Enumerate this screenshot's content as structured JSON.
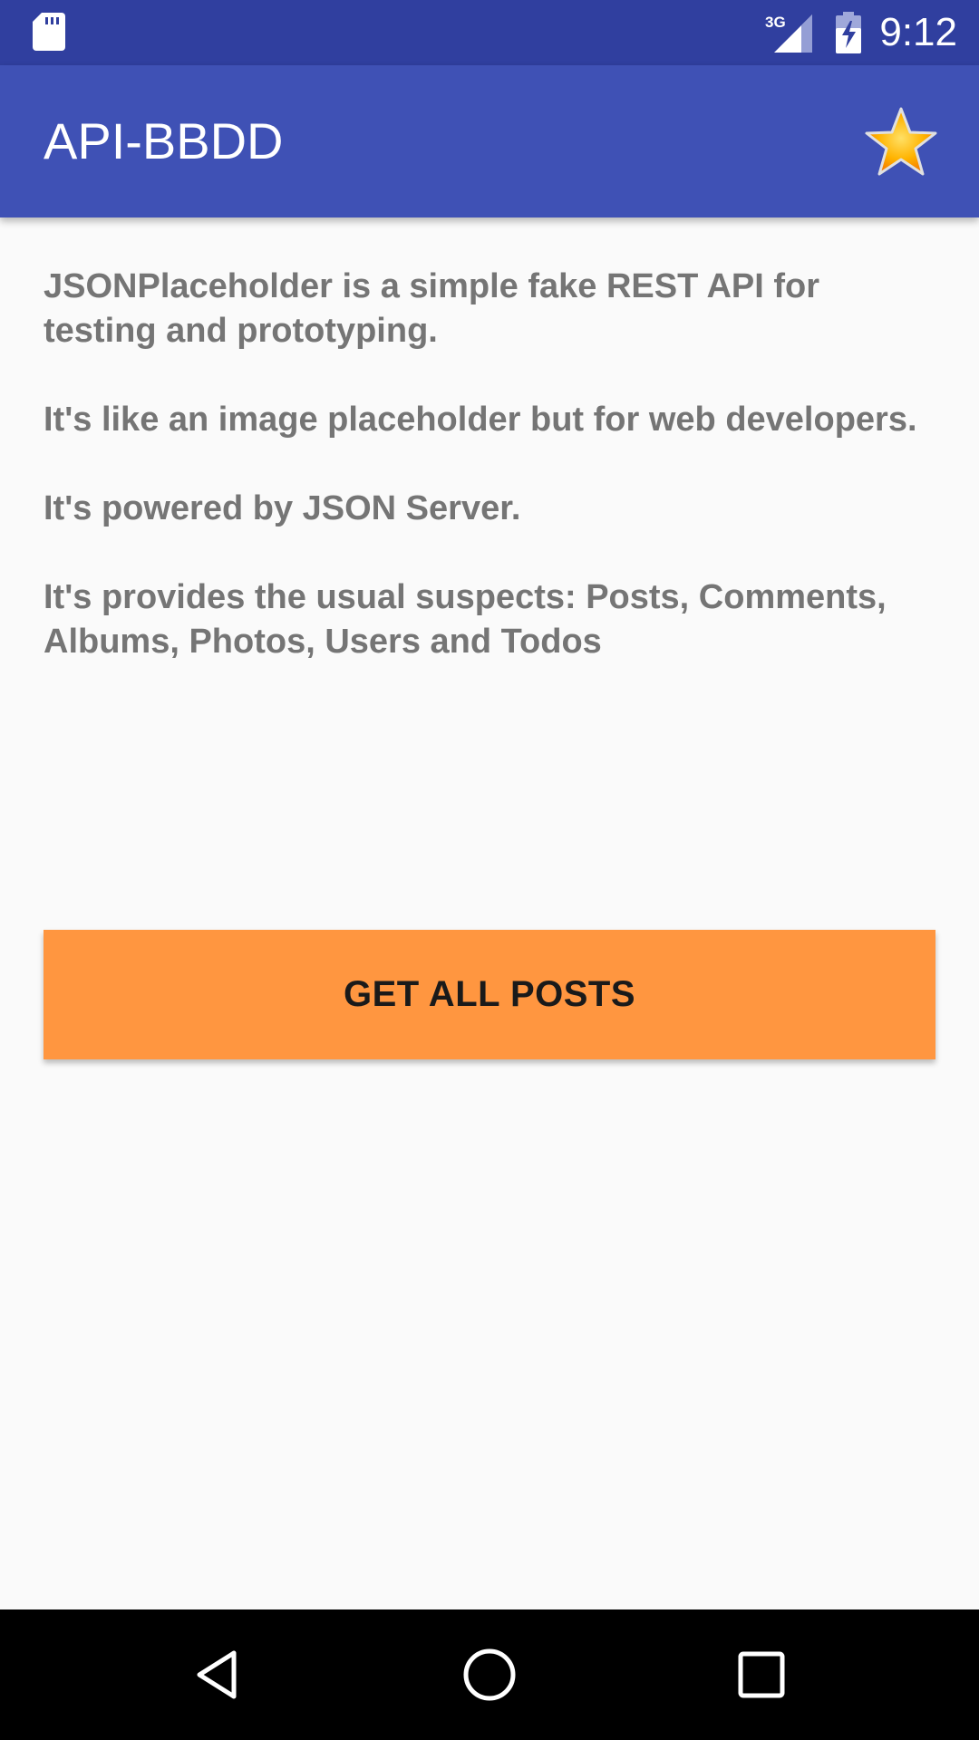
{
  "status_bar": {
    "time": "9:12",
    "network_type": "3G",
    "icons": [
      "sd-card-icon",
      "signal-3g-icon",
      "battery-charging-icon"
    ]
  },
  "app_bar": {
    "title": "API-BBDD",
    "action_icon": "star-icon"
  },
  "content": {
    "paragraphs": [
      "JSONPlaceholder is a simple fake REST API for testing and prototyping.",
      "It's like an image placeholder but for web developers.",
      "It's powered by JSON Server.",
      "It's provides the usual suspects: Posts, Comments, Albums, Photos, Users and Todos"
    ]
  },
  "button": {
    "label": "GET ALL POSTS"
  },
  "nav_bar": {
    "icons": [
      "back-icon",
      "home-icon",
      "recent-apps-icon"
    ]
  },
  "colors": {
    "status_bar": "#303f9f",
    "app_bar": "#3f51b5",
    "background": "#fafafa",
    "text": "#757575",
    "button": "#ff9640",
    "star": "#ffb300"
  }
}
